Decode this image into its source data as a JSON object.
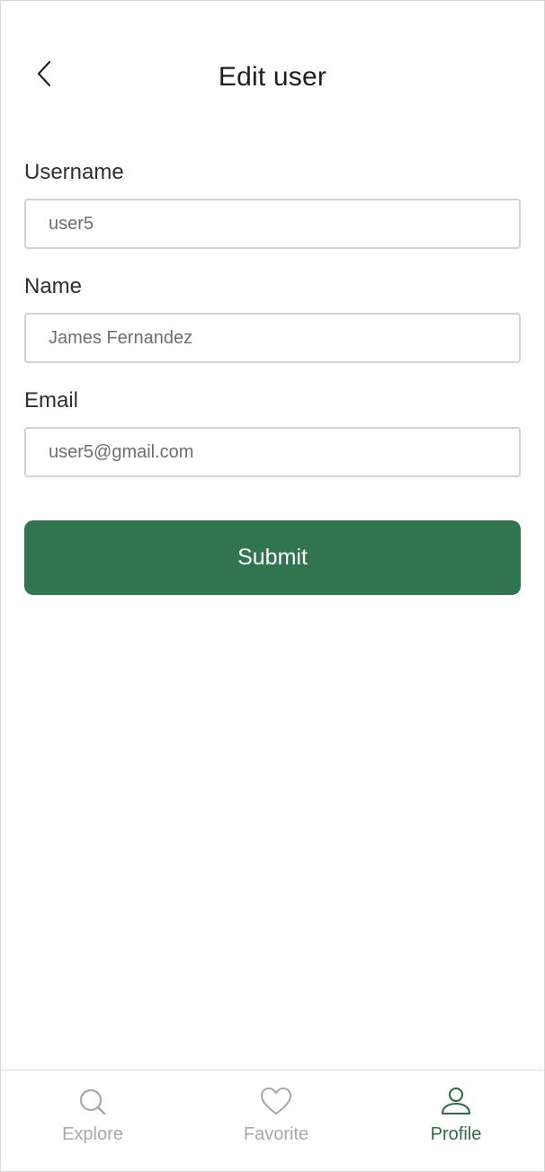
{
  "header": {
    "title": "Edit user",
    "back_icon": "chevron-left-icon"
  },
  "form": {
    "username": {
      "label": "Username",
      "value": "user5"
    },
    "name": {
      "label": "Name",
      "value": "James Fernandez"
    },
    "email": {
      "label": "Email",
      "value": "user5@gmail.com"
    },
    "submit_label": "Submit"
  },
  "tabbar": {
    "tabs": [
      {
        "label": "Explore",
        "icon": "search-icon",
        "active": false
      },
      {
        "label": "Favorite",
        "icon": "heart-icon",
        "active": false
      },
      {
        "label": "Profile",
        "icon": "user-icon",
        "active": true
      }
    ]
  },
  "colors": {
    "accent": "#317450",
    "active_tab": "#2f6b46",
    "inactive_tab": "#a8a8a8",
    "input_border": "#d3d3d3"
  }
}
